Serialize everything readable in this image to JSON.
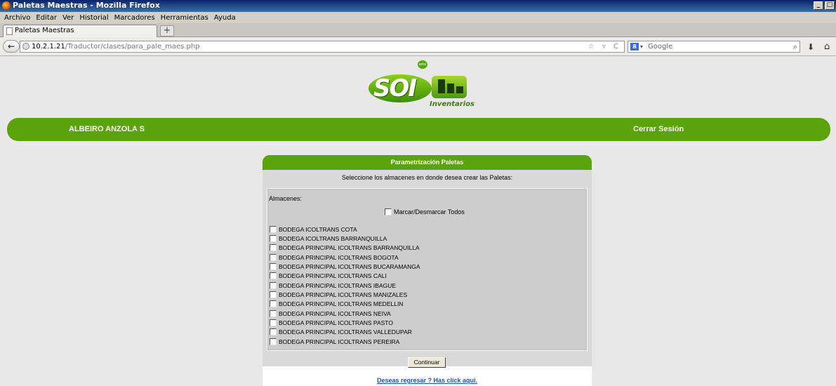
{
  "window": {
    "title": "Paletas Maestras - Mozilla Firefox",
    "controls": [
      "_",
      "□",
      "×"
    ]
  },
  "menu": [
    "Archivo",
    "Editar",
    "Ver",
    "Historial",
    "Marcadores",
    "Herramientas",
    "Ayuda"
  ],
  "tab": {
    "label": "Paletas Maestras",
    "new_tab": "+"
  },
  "nav": {
    "url_host": "10.2.1.21",
    "url_path": "/Traductor/clases/para_pale_maes.php",
    "url_icons": "☆ ▿ C",
    "search_placeholder": "Google",
    "search_engine_icon": "8",
    "search_caret": "▾",
    "search_icon": "⌕",
    "download_icon": "⬇",
    "home_icon": "⌂",
    "back_icon": "←"
  },
  "logo": {
    "text": "SOI",
    "badge": "ams",
    "subtitle": "Inventarios"
  },
  "header": {
    "user": "ALBEIRO ANZOLA S",
    "logout": "Cerrar Sesión"
  },
  "panel": {
    "title": "Parametrización Paletas",
    "instructions": "Seleccione los almacenes en donde desea crear las Paletas:",
    "almacenes_label": "Almacenes:",
    "toggle_all": "Marcar/Desmarcar Todos",
    "warehouses": [
      "BODEGA ICOLTRANS COTA",
      "BODEGA ICOLTRANS BARRANQUILLA",
      "BODEGA PRINCIPAL ICOLTRANS BARRANQUILLA",
      "BODEGA PRINCIPAL ICOLTRANS BOGOTA",
      "BODEGA PRINCIPAL ICOLTRANS BUCARAMANGA",
      "BODEGA PRINCIPAL ICOLTRANS CALI",
      "BODEGA PRINCIPAL ICOLTRANS IBAGUE",
      "BODEGA PRINCIPAL ICOLTRANS MANIZALES",
      "BODEGA PRINCIPAL ICOLTRANS MEDELLIN",
      "BODEGA PRINCIPAL ICOLTRANS NEIVA",
      "BODEGA PRINCIPAL ICOLTRANS PASTO",
      "BODEGA PRINCIPAL ICOLTRANS VALLEDUPAR",
      "BODEGA PRINCIPAL ICOLTRANS PEREIRA"
    ],
    "submit": "Continuar",
    "back_link": "Deseas regresar ? Has click aqui."
  },
  "colors": {
    "accent_green": "#5aa30a",
    "link_blue": "#1a56b0"
  }
}
